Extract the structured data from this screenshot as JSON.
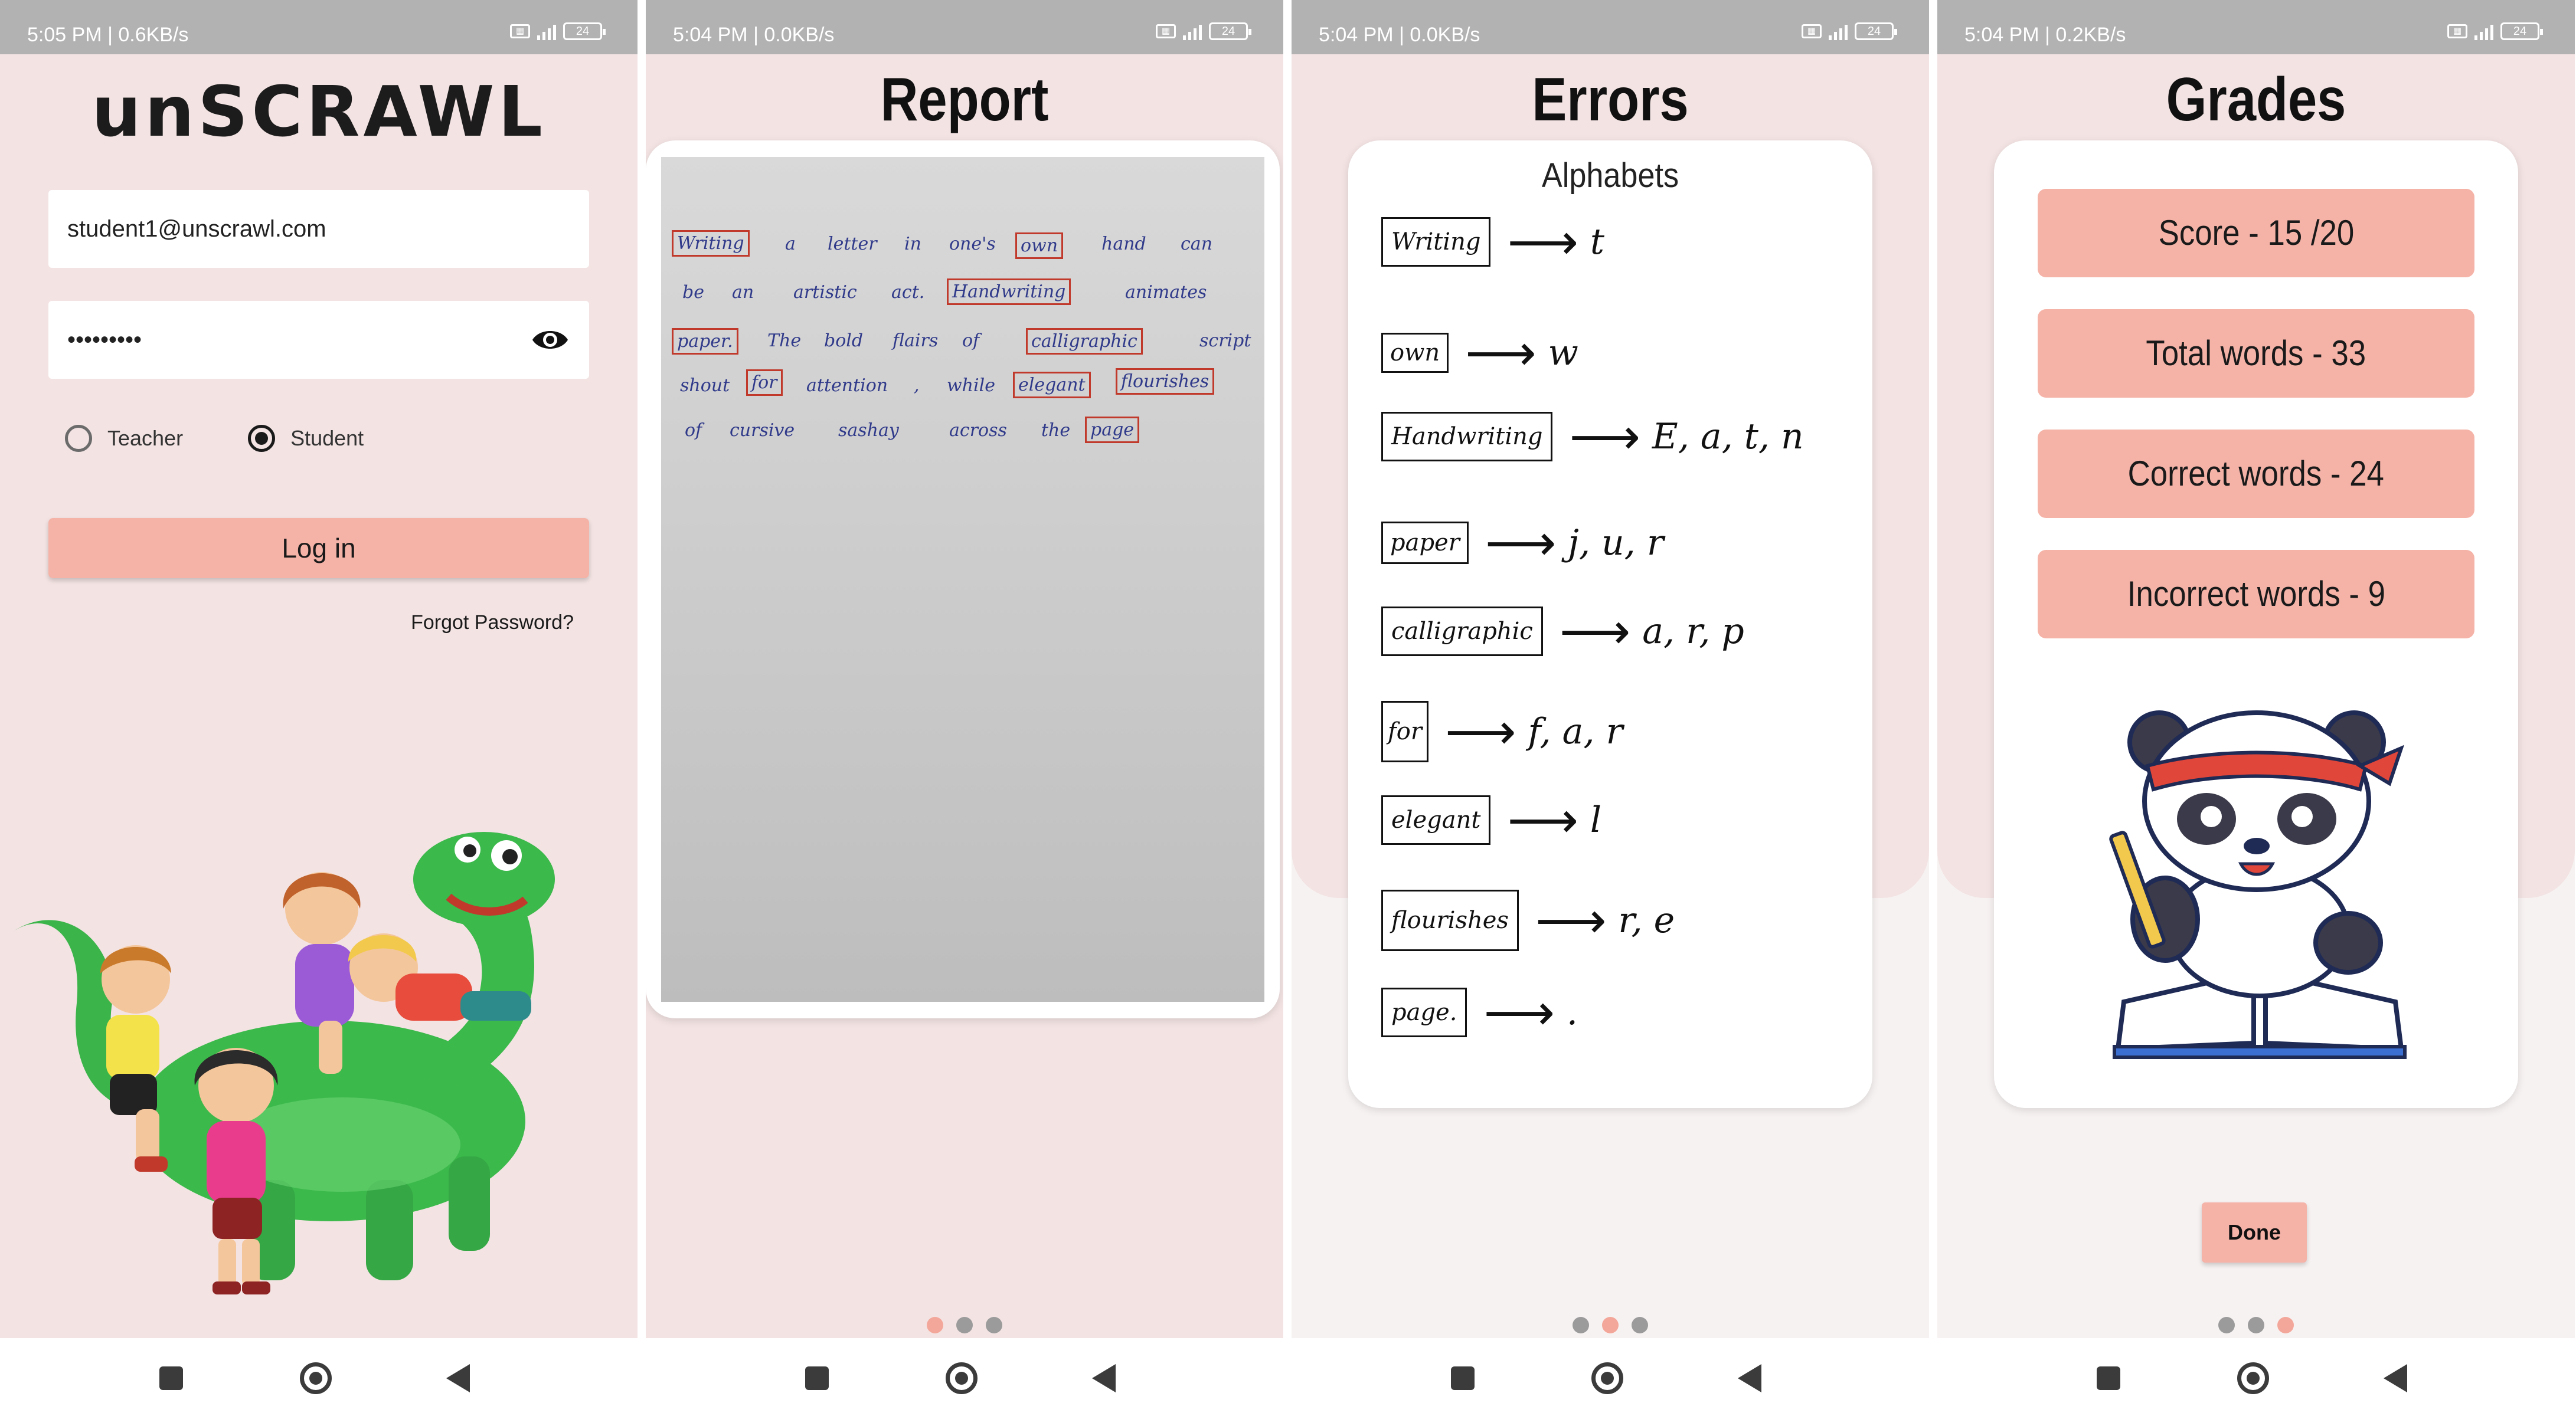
{
  "status_bars": [
    {
      "time": "5:05 PM | 0.6KB/s",
      "battery": "24"
    },
    {
      "time": "5:04 PM | 0.0KB/s",
      "battery": "24"
    },
    {
      "time": "5:04 PM | 0.0KB/s",
      "battery": "24"
    },
    {
      "time": "5:04 PM | 0.2KB/s",
      "battery": "24"
    }
  ],
  "login": {
    "logo": "unSCRAWL",
    "email_value": "student1@unscrawl.com",
    "password_value": "•••••••••",
    "roles": [
      "Teacher",
      "Student"
    ],
    "selected_role": "Student",
    "login_label": "Log in",
    "forgot_label": "Forgot Password?"
  },
  "report": {
    "title": "Report",
    "text_words": [
      "Writing",
      "a",
      "letter",
      "in",
      "one's",
      "own",
      "hand",
      "can",
      "be",
      "an",
      "artistic",
      "act.",
      "Handwriting",
      "animates",
      "paper.",
      "The",
      "bold",
      "flairs",
      "of",
      "calligraphic",
      "script",
      "shout",
      "for",
      "attention",
      ",",
      "while",
      "elegant",
      "flourishes",
      "of",
      "cursive",
      "sashay",
      "across",
      "the",
      "page"
    ],
    "highlighted": [
      "Writing",
      "own",
      "Handwriting",
      "paper",
      "calligraphic",
      "for",
      "elegant",
      "flourishes",
      "page"
    ]
  },
  "errors": {
    "title": "Errors",
    "subtitle": "Alphabets",
    "items": [
      {
        "word": "Writing",
        "letters": "t"
      },
      {
        "word": "own",
        "letters": "w"
      },
      {
        "word": "Handwriting",
        "letters": "E, a, t, n"
      },
      {
        "word": "paper",
        "letters": "j, u, r"
      },
      {
        "word": "calligraphic",
        "letters": "a, r, p"
      },
      {
        "word": "for",
        "letters": "f, a, r"
      },
      {
        "word": "elegant",
        "letters": "l"
      },
      {
        "word": "flourishes",
        "letters": "r, e"
      },
      {
        "word": "page.",
        "letters": "."
      }
    ]
  },
  "grades": {
    "title": "Grades",
    "score": "Score - 15 /20",
    "total": "Total words - 33",
    "correct": "Correct words - 24",
    "incorrect": "Incorrect words - 9",
    "done_label": "Done"
  },
  "pager": {
    "pages": 3,
    "active_report": 0,
    "active_errors": 1,
    "active_grades": 2
  },
  "colors": {
    "accent": "#f5b3a8",
    "background": "#f3e3e3",
    "highlight_box": "#c0392b",
    "ink": "#303a8a"
  }
}
